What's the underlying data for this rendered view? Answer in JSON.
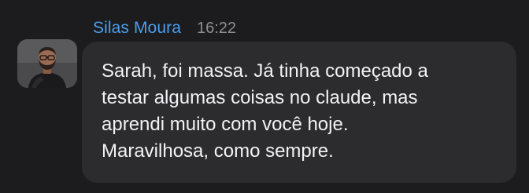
{
  "message": {
    "sender_name": "Silas Moura",
    "timestamp": "16:22",
    "avatar_icon": "user-avatar-photo",
    "text": "Sarah, foi massa. Já tinha começado a\ntestar algumas coisas no claude, mas\naprendi muito com você hoje.\nMaravilhosa, como sempre."
  },
  "colors": {
    "background": "#1c1c1e",
    "bubble": "#2c2c2e",
    "sender_name": "#4a9eef",
    "timestamp": "#8e8e93",
    "text": "#f2f2f7"
  }
}
